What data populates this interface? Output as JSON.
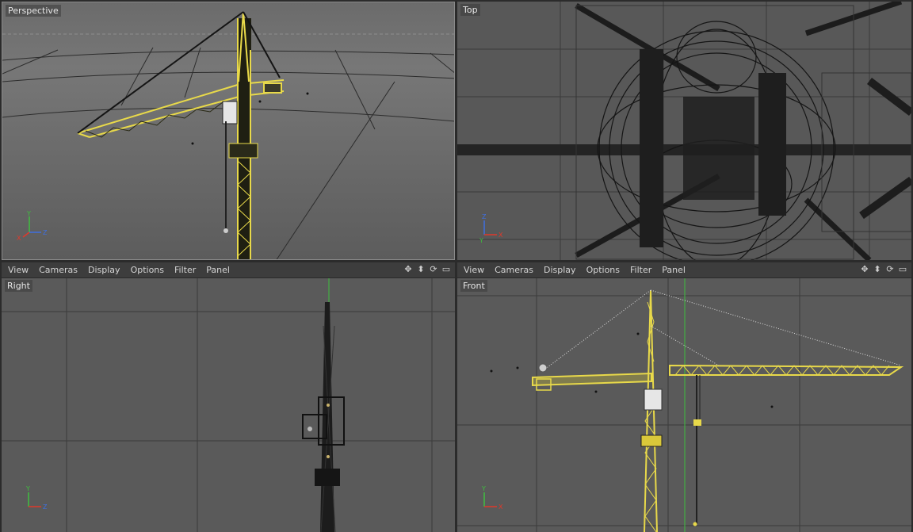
{
  "menu": [
    "View",
    "Cameras",
    "Display",
    "Options",
    "Filter",
    "Panel"
  ],
  "viewports": {
    "perspective": {
      "label": "Perspective"
    },
    "top": {
      "label": "Top"
    },
    "right": {
      "label": "Right"
    },
    "front": {
      "label": "Front"
    }
  },
  "axes": {
    "y": "Y",
    "x": "X",
    "z": "Z"
  },
  "icons": [
    "move-view-icon",
    "zoom-view-icon",
    "rotate-view-icon",
    "panel-toggle-icon"
  ],
  "colors": {
    "viewport_bg": "#5a5a5a",
    "menubar_bg": "#3d3d3d",
    "crane_yellow": "#e8d94a",
    "wire_dark": "#1a1a1a",
    "axis_x": "#e0392b",
    "axis_y": "#3fbf3f",
    "axis_z": "#3f6fe0"
  }
}
